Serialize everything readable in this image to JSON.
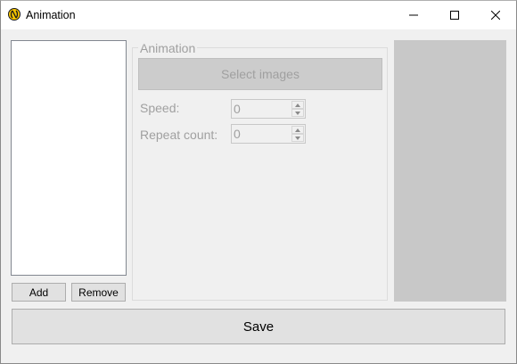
{
  "window": {
    "title": "Animation",
    "icon": "app-logo-icon",
    "controls": [
      "minimize-icon",
      "maximize-icon",
      "close-icon"
    ]
  },
  "list": {
    "items": [],
    "add_label": "Add",
    "remove_label": "Remove"
  },
  "animation_group": {
    "label": "Animation",
    "select_images_label": "Select images",
    "speed": {
      "label": "Speed:",
      "value": "0"
    },
    "repeat_count": {
      "label": "Repeat count:",
      "value": "0"
    }
  },
  "save_label": "Save",
  "colors": {
    "disabled_text": "#a0a0a0",
    "preview_bg": "#c8c8c8",
    "window_bg": "#f0f0f0"
  }
}
